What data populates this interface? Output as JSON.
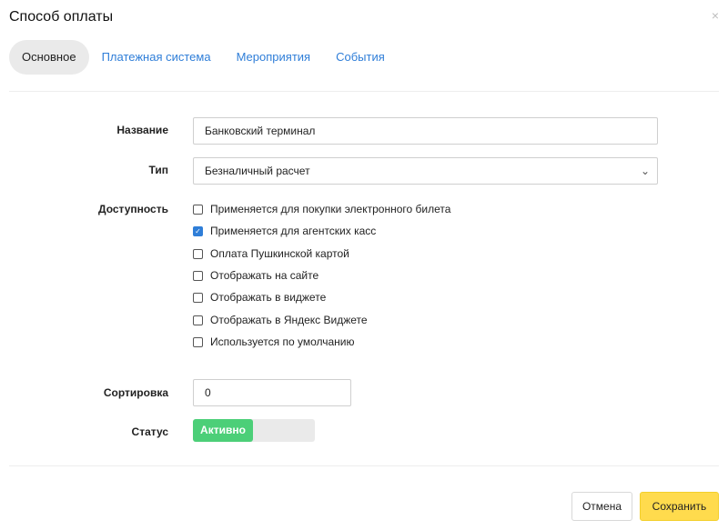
{
  "modal": {
    "title": "Способ оплаты",
    "close_glyph": "×"
  },
  "tabs": [
    {
      "label": "Основное",
      "active": true
    },
    {
      "label": "Платежная система",
      "active": false
    },
    {
      "label": "Мероприятия",
      "active": false
    },
    {
      "label": "События",
      "active": false
    }
  ],
  "form": {
    "name": {
      "label": "Название",
      "value": "Банковский терминал"
    },
    "type": {
      "label": "Тип",
      "value": "Безналичный расчет"
    },
    "availability": {
      "label": "Доступность",
      "options": [
        {
          "label": "Применяется для покупки электронного билета",
          "checked": false
        },
        {
          "label": "Применяется для агентских касс",
          "checked": true
        },
        {
          "label": "Оплата Пушкинской картой",
          "checked": false
        },
        {
          "label": "Отображать на сайте",
          "checked": false
        },
        {
          "label": "Отображать в виджете",
          "checked": false
        },
        {
          "label": "Отображать в Яндекс Виджете",
          "checked": false
        },
        {
          "label": "Используется по умолчанию",
          "checked": false
        }
      ]
    },
    "sort": {
      "label": "Сортировка",
      "value": "0"
    },
    "status": {
      "label": "Статус",
      "value": "Активно",
      "color": "#4ccf78"
    }
  },
  "footer": {
    "cancel_label": "Отмена",
    "save_label": "Сохранить"
  },
  "colors": {
    "accent": "#2f7ed8",
    "save_button": "#ffdb4d",
    "active_tab_bg": "#eaeaea"
  }
}
